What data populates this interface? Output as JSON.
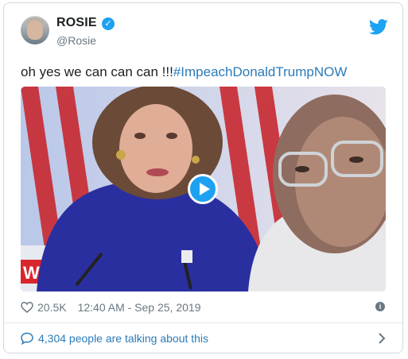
{
  "tweet": {
    "display_name": "ROSIE",
    "handle": "@Rosie",
    "text_main": "oh yes we can can can !!!",
    "hashtag": "#ImpeachDonaldTrumpNOW",
    "likes": "20.5K",
    "timestamp": "12:40 AM - Sep 25, 2019",
    "talking": "4,304 people are talking about this",
    "media_overlay_text": "WS"
  },
  "icons": {
    "verified": "verified-badge-icon",
    "platform": "twitter-bird-icon",
    "like": "heart-icon",
    "info": "info-icon",
    "conversation": "speech-bubble-icon",
    "play": "play-icon",
    "more": "chevron-right-icon"
  },
  "colors": {
    "accent": "#1da1f2",
    "link": "#2b7bb9",
    "muted": "#697882",
    "text": "#1c2022"
  }
}
